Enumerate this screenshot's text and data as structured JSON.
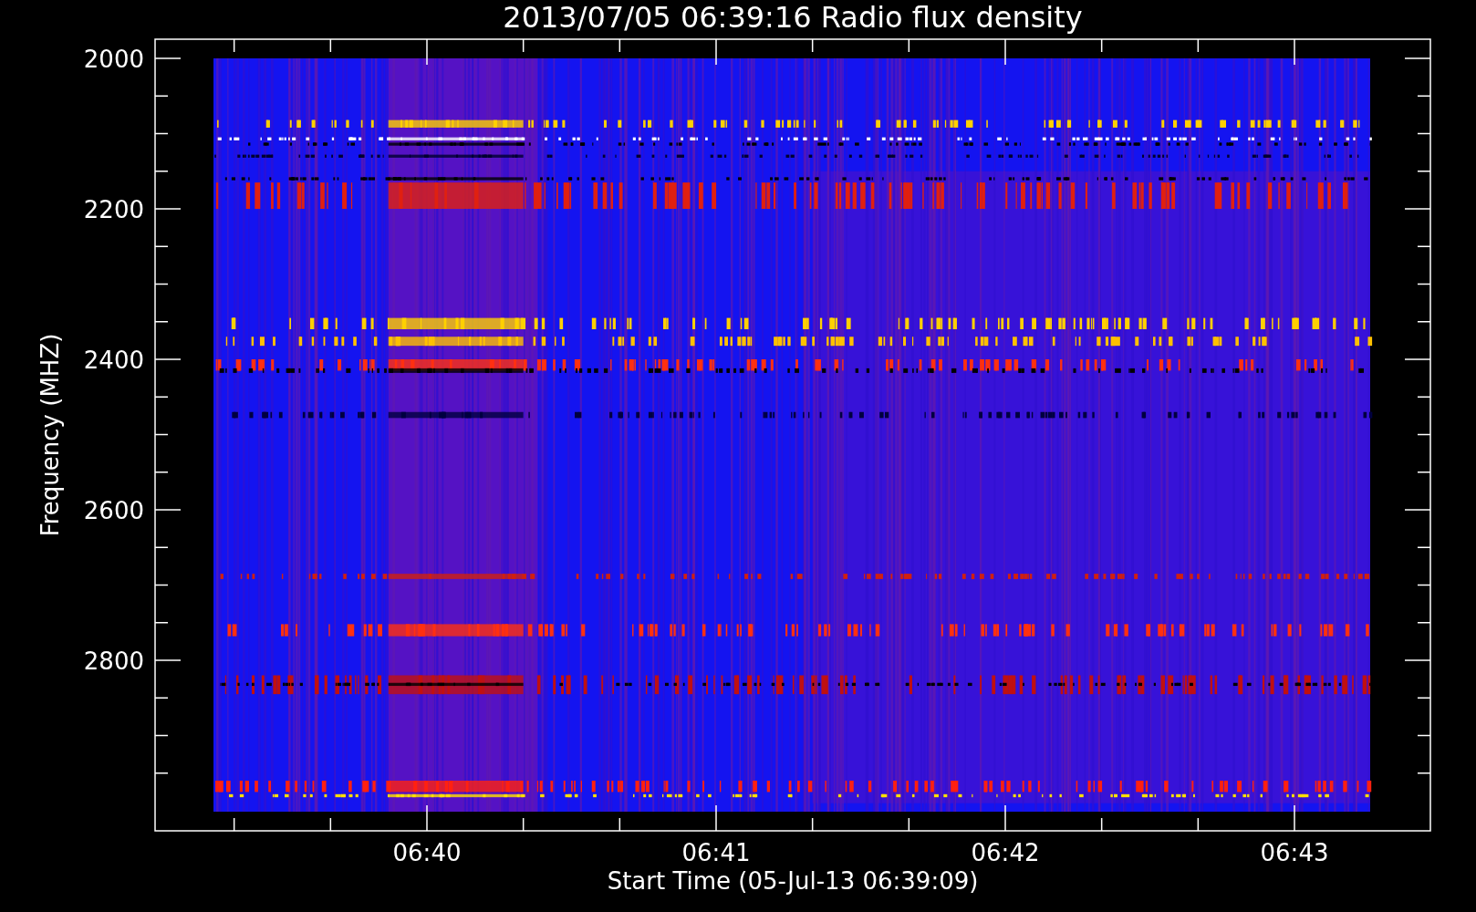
{
  "title": "2013/07/05 06:39:16 Radio flux density",
  "y_axis": {
    "label": "Frequency (MHZ)",
    "ticks": [
      "2000",
      "2200",
      "2400",
      "2600",
      "2800"
    ]
  },
  "x_axis": {
    "label": "Start Time (05-Jul-13 06:39:09)",
    "ticks": [
      "06:40",
      "06:41",
      "06:42",
      "06:43"
    ]
  }
}
